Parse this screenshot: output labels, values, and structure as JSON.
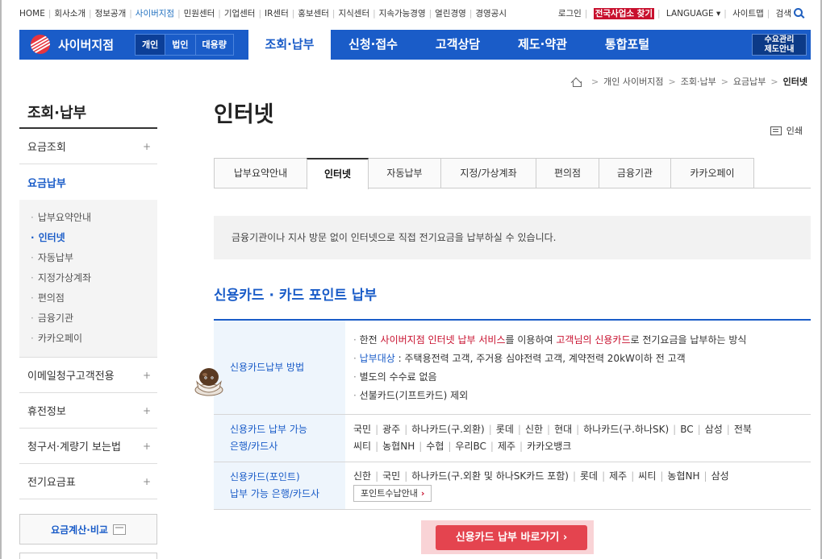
{
  "util": {
    "left_links": [
      "HOME",
      "회사소개",
      "정보공개",
      "사이버지점",
      "민원센터",
      "기업센터",
      "IR센터",
      "홍보센터",
      "지식센터",
      "지속가능경영",
      "열린경영",
      "경영공시"
    ],
    "active_left": "사이버지점",
    "login": "로그인",
    "find_branch": "전국사업소 찾기",
    "language": "LANGUAGE",
    "sitemap": "사이트맵",
    "search": "검색"
  },
  "gnb": {
    "logo": "사이버지점",
    "segments": [
      "개인",
      "법인",
      "대용량"
    ],
    "active_segment": "개인",
    "menu": [
      "조회·납부",
      "신청·접수",
      "고객상담",
      "제도·약관",
      "통합포털"
    ],
    "active_menu": "조회·납부",
    "demand_btn_line1": "수요관리",
    "demand_btn_line2": "제도안내"
  },
  "breadcrumb": [
    "개인 사이버지점",
    "조회·납부",
    "요금납부",
    "인터넷"
  ],
  "lnb": {
    "title": "조회·납부",
    "items_top": [
      {
        "label": "요금조회",
        "plus": "+"
      },
      {
        "label": "요금납부",
        "plus": ""
      }
    ],
    "sub": [
      "납부요약안내",
      "인터넷",
      "자동납부",
      "지정가상계좌",
      "편의점",
      "금융기관",
      "카카오페이"
    ],
    "active_sub": "인터넷",
    "items_bottom": [
      {
        "label": "이메일청구고객전용",
        "plus": "+"
      },
      {
        "label": "휴전정보",
        "plus": "+"
      },
      {
        "label": "청구서·계량기 보는법",
        "plus": "+"
      },
      {
        "label": "전기요금표",
        "plus": "+"
      }
    ],
    "calc": "요금계산·비교"
  },
  "content": {
    "title": "인터넷",
    "print": "인쇄",
    "tabs": [
      "납부요약안내",
      "인터넷",
      "자동납부",
      "지정/가상계좌",
      "편의점",
      "금융기관",
      "카카오페이"
    ],
    "active_tab": "인터넷",
    "info": "금융기관이나 지사 방문 없이 인터넷으로 직접 전기요금을 납부하실 수 있습니다.",
    "section_title": "신용카드 · 카드 포인트 납부",
    "row1": {
      "th": "신용카드납부 방법",
      "l1a": "한전 ",
      "l1b": "사이버지점 인터넷 납부 서비스",
      "l1c": "를 이용하여 ",
      "l1d": "고객님의 신용카드",
      "l1e": "로 전기요금을 납부하는 방식",
      "l2a": "납부대상",
      "l2b": " : 주택용전력 고객, 주거용 심야전력 고객, 계약전력 20kW이하 전 고객",
      "l3": "별도의 수수료 없음",
      "l4": "선불카드(기프트카드) 제외"
    },
    "row2": {
      "th1": "신용카드 납부 가능",
      "th2": "은행/카드사",
      "line1": [
        "국민",
        "광주",
        "하나카드(구.외환)",
        "롯데",
        "신한",
        "현대",
        "하나카드(구.하나SK)",
        "BC",
        "삼성",
        "전북"
      ],
      "line2": [
        "씨티",
        "농협NH",
        "수협",
        "우리BC",
        "제주",
        "카카오뱅크"
      ]
    },
    "row3": {
      "th1": "신용카드(포인트)",
      "th2": "납부 가능 은행/카드사",
      "line1": [
        "신한",
        "국민",
        "하나카드(구.외환 및 하나SK카드 포함)",
        "롯데",
        "제주",
        "씨티",
        "농협NH",
        "삼성"
      ],
      "button": "포인트수납안내"
    },
    "cta": "신용카드 납부 바로가기"
  },
  "colors": {
    "brand": "#1a5cc8",
    "accent_red": "#c8102e",
    "cta": "#e4444f"
  }
}
